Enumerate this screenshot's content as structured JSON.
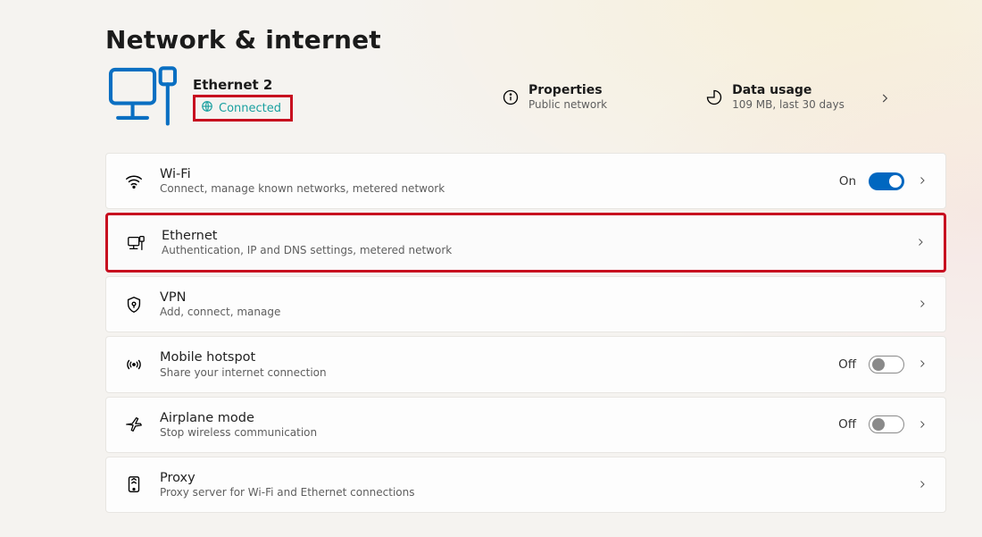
{
  "page_title": "Network & internet",
  "connection": {
    "name": "Ethernet 2",
    "status": "Connected"
  },
  "quick": {
    "properties": {
      "title": "Properties",
      "sub": "Public network"
    },
    "usage": {
      "title": "Data usage",
      "sub": "109 MB, last 30 days"
    }
  },
  "labels": {
    "on": "On",
    "off": "Off"
  },
  "rows": {
    "wifi": {
      "title": "Wi-Fi",
      "sub": "Connect, manage known networks, metered network",
      "toggle": "on"
    },
    "ethernet": {
      "title": "Ethernet",
      "sub": "Authentication, IP and DNS settings, metered network"
    },
    "vpn": {
      "title": "VPN",
      "sub": "Add, connect, manage"
    },
    "hotspot": {
      "title": "Mobile hotspot",
      "sub": "Share your internet connection",
      "toggle": "off"
    },
    "airplane": {
      "title": "Airplane mode",
      "sub": "Stop wireless communication",
      "toggle": "off"
    },
    "proxy": {
      "title": "Proxy",
      "sub": "Proxy server for Wi-Fi and Ethernet connections"
    }
  }
}
